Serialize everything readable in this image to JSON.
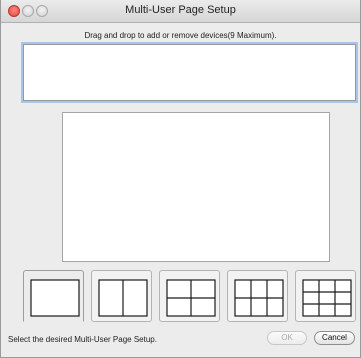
{
  "window": {
    "title": "Multi-User Page Setup"
  },
  "instruction": "Drag and drop to add or remove devices(9 Maximum).",
  "layouts": [
    {
      "name": "1x1",
      "cols": 1,
      "rows": 1,
      "selected": true
    },
    {
      "name": "1x2",
      "cols": 2,
      "rows": 1,
      "selected": false
    },
    {
      "name": "2x2",
      "cols": 2,
      "rows": 2,
      "selected": false
    },
    {
      "name": "2x3",
      "cols": 3,
      "rows": 2,
      "selected": false
    },
    {
      "name": "3x3",
      "cols": 3,
      "rows": 3,
      "selected": false
    }
  ],
  "status_text": "Select the desired Multi-User Page Setup.",
  "buttons": {
    "ok_label": "OK",
    "ok_enabled": false,
    "cancel_label": "Cancel"
  },
  "colors": {
    "close_button": "#e0443e",
    "focus_ring": "#a9c4e6"
  },
  "icons": {
    "close": "close-window-icon",
    "minimize": "minimize-window-icon",
    "zoom": "zoom-window-icon"
  }
}
